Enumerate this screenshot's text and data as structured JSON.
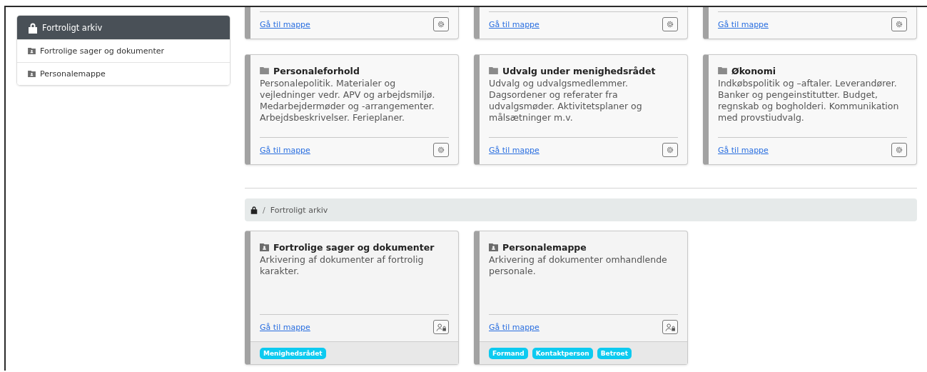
{
  "sidebar": {
    "header": "Fortroligt arkiv",
    "items": [
      {
        "label": "Fortrolige sager og dokumenter"
      },
      {
        "label": "Personalemappe"
      }
    ]
  },
  "cut_cards": [
    {
      "link": "Gå til mappe",
      "kind": "settings"
    },
    {
      "link": "Gå til mappe",
      "kind": "settings"
    },
    {
      "link": "Gå til mappe",
      "kind": "settings"
    }
  ],
  "folder_cards": [
    {
      "title": "Personaleforhold",
      "description": "Personalepolitik. Materialer og vejledninger vedr. APV og arbejdsmiljø. Medarbejdermøder og -arrangementer. Arbejdsbeskrivelser. Ferieplaner.",
      "link": "Gå til mappe",
      "kind": "settings"
    },
    {
      "title": "Udvalg under menighedsrådet",
      "description": "Udvalg og udvalgsmedlemmer. Dagsordener og referater fra udvalgsmøder. Aktivitetsplaner og målsætninger m.v.",
      "link": "Gå til mappe",
      "kind": "settings"
    },
    {
      "title": "Økonomi",
      "description": "Indkøbspolitik og –aftaler. Leverandører. Banker og pengeinstitutter. Budget, regnskab og bogholderi. Kommunikation med provstiudvalg.",
      "link": "Gå til mappe",
      "kind": "settings"
    }
  ],
  "breadcrumb": {
    "separator": "/",
    "current": "Fortroligt arkiv"
  },
  "archive_cards": [
    {
      "title": "Fortrolige sager og dokumenter",
      "description": "Arkivering af dokumenter af fortrolig karakter.",
      "link": "Gå til mappe",
      "kind": "access",
      "tags": [
        "Menighedsrådet"
      ]
    },
    {
      "title": "Personalemappe",
      "description": "Arkivering af dokumenter omhandlende personale.",
      "link": "Gå til mappe",
      "kind": "access",
      "tags": [
        "Formand",
        "Kontaktperson",
        "Betroet"
      ]
    }
  ]
}
